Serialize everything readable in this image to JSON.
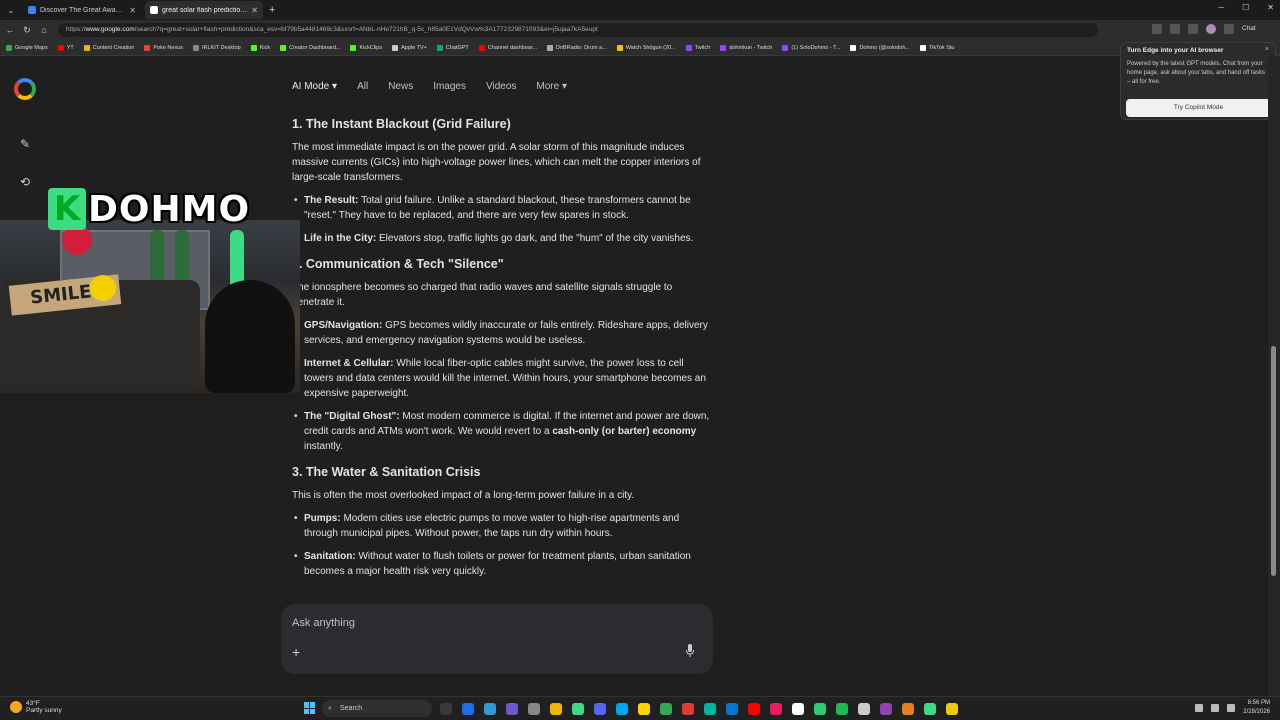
{
  "browser": {
    "tabs": [
      {
        "title": "Discover The Great Awakening M...",
        "fav_color": "#3b82f6",
        "active": false
      },
      {
        "title": "great solar flash prediction - Goog...",
        "fav_color": "#ffffff",
        "active": true
      }
    ],
    "new_tab": "+",
    "url_prefix": "https://",
    "url_host": "www.google.com",
    "url_rest": "/search?q=great+solar+flash+prediction&sca_esv=bf79b5a4481469c3&sxsrf=ANbL-nHe721hB_q-5c_h85a0E1VdQvVw%3A1772329871093&ei=j5ujaa7kA5eupt",
    "copilot_label": "Chat",
    "bookmarks": [
      {
        "label": "Google Maps",
        "color": "#34a853"
      },
      {
        "label": "YT",
        "color": "#ff0000"
      },
      {
        "label": "Content Creation",
        "color": "#f4b400"
      },
      {
        "label": "Poke Nexus",
        "color": "#ea4335"
      },
      {
        "label": "IRLKIT Desktop",
        "color": "#888888"
      },
      {
        "label": "Kick",
        "color": "#53fc18"
      },
      {
        "label": "Creator Dashboard...",
        "color": "#53fc18"
      },
      {
        "label": "KickClips",
        "color": "#53fc18"
      },
      {
        "label": "Apple TV+",
        "color": "#cccccc"
      },
      {
        "label": "ChatGPT",
        "color": "#10a37f"
      },
      {
        "label": "Channel dashboar...",
        "color": "#ff0000"
      },
      {
        "label": "DnBRadio: Drum a...",
        "color": "#aaaaaa"
      },
      {
        "label": "Watch Shōgun (20...",
        "color": "#f4c20d"
      },
      {
        "label": "Twitch",
        "color": "#9146ff"
      },
      {
        "label": "dohmkun - Twitch",
        "color": "#9146ff"
      },
      {
        "label": "(1) SoloDohmo - T...",
        "color": "#9146ff"
      },
      {
        "label": "Dohmo (@solodoh...",
        "color": "#ffffff"
      },
      {
        "label": "TikTok Stu",
        "color": "#ffffff"
      }
    ]
  },
  "search_nav": {
    "items": [
      "AI Mode",
      "All",
      "News",
      "Images",
      "Videos",
      "More"
    ],
    "ai_mode_caret": "▾",
    "more_caret": "▾"
  },
  "content": {
    "s1_heading": "1. The Instant Blackout (Grid Failure)",
    "s1_intro": "The most immediate impact is on the power grid. A solar storm of this magnitude induces massive currents (GICs) into high-voltage power lines, which can melt the copper interiors of large-scale transformers.",
    "s1_items": [
      {
        "label": "The Result:",
        "text": "Total grid failure. Unlike a standard blackout, these transformers cannot be \"reset.\" They have to be replaced, and there are very few spares in stock."
      },
      {
        "label": "Life in the City:",
        "text": "Elevators stop, traffic lights go dark, and the \"hum\" of the city vanishes."
      }
    ],
    "s2_heading": "2. Communication & Tech \"Silence\"",
    "s2_intro": "The ionosphere becomes so charged that radio waves and satellite signals struggle to penetrate it.",
    "s2_items": [
      {
        "label": "GPS/Navigation:",
        "text": "GPS becomes wildly inaccurate or fails entirely. Rideshare apps, delivery services, and emergency navigation systems would be useless."
      },
      {
        "label": "Internet & Cellular:",
        "text": "While local fiber-optic cables might survive, the power loss to cell towers and data centers would kill the internet. Within hours, your smartphone becomes an expensive paperweight."
      }
    ],
    "s2_item3_label": "The \"Digital Ghost\":",
    "s2_item3_text": "Most modern commerce is digital. If the internet and power are down, credit cards and ATMs won't work. We would revert to a",
    "s2_item3_bold": "cash-only (or barter) economy",
    "s2_item3_end": "instantly.",
    "s3_heading": "3. The Water & Sanitation Crisis",
    "s3_intro": "This is often the most overlooked impact of a long-term power failure in a city.",
    "s3_items": [
      {
        "label": "Pumps:",
        "text": "Modern cities use electric pumps to move water to high-rise apartments and through municipal pipes. Without power, the taps run dry within hours."
      },
      {
        "label": "Sanitation:",
        "text": "Without water to flush toilets or power for treatment plants, urban sanitation becomes a major health risk very quickly."
      }
    ]
  },
  "overlay": {
    "logo_k": "K",
    "logo_text": "DOHMO",
    "smile_sign": "SMILE!"
  },
  "popup": {
    "title": "Turn Edge into your AI browser",
    "body": "Powered by the latest GPT models. Chat from your home page, ask about your tabs, and hand off tasks – all for free.",
    "button": "Try Copilot Mode",
    "close": "×"
  },
  "ask": {
    "placeholder": "Ask anything",
    "plus": "+"
  },
  "taskbar": {
    "temp": "43°F",
    "weather": "Partly sunny",
    "search_label": "Search",
    "time": "8:56 PM",
    "date": "2/28/2026",
    "app_colors": [
      "#3a3a3a",
      "#1f6feb",
      "#2f9bd6",
      "#6a5acd",
      "#888888",
      "#f4b400",
      "#3ddc84",
      "#5865f2",
      "#00a4ef",
      "#ffd400",
      "#34a853",
      "#e53935",
      "#00b4a0",
      "#0078d4",
      "#ff0000",
      "#e91e63",
      "#ffffff",
      "#2ecc71",
      "#1db954",
      "#cccccc",
      "#8e44ad",
      "#e67e22",
      "#3ddc84",
      "#f1c40f"
    ]
  }
}
